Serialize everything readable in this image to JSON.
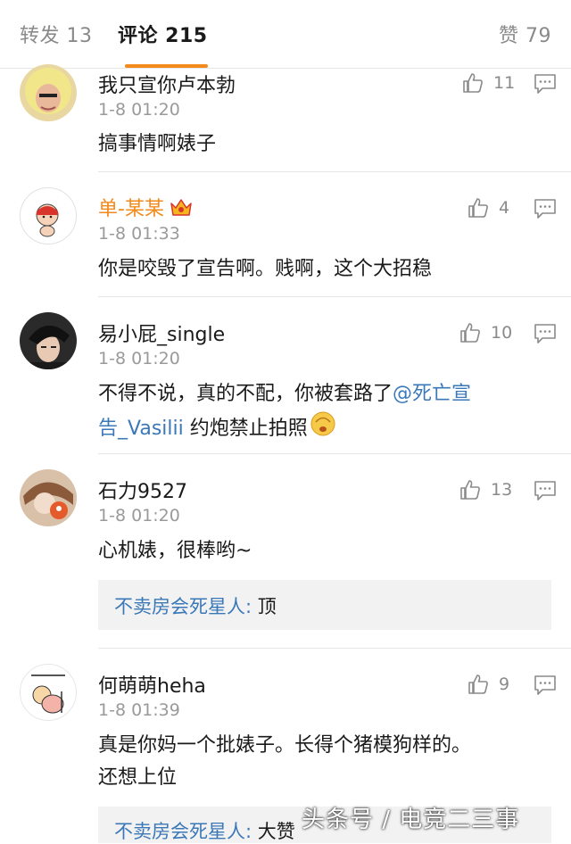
{
  "tabs": {
    "repost": "转发 13",
    "comment": "评论 215",
    "like": "赞 79"
  },
  "comments": [
    {
      "user": "我只宣你卢本勃",
      "time": "1-8 01:20",
      "text": "搞事情啊婊子",
      "likes": "11",
      "avatar": "blonde-avatar"
    },
    {
      "user": "单-某某",
      "time": "1-8 01:33",
      "text": "你是咬毁了宣告啊。贱啊，这个大招稳",
      "likes": "4",
      "avatar": "cartoon-avatar",
      "name_color": "#f28a1c"
    },
    {
      "user": "易小屁_single",
      "time": "1-8 01:20",
      "text_a": "不得不说，真的不配，你被套路了",
      "mention_a": "@死亡宣",
      "mention_b": "告_Vasilii",
      "text_b": " 约炮禁止拍照",
      "likes": "10",
      "avatar": "dark-hair-avatar"
    },
    {
      "user": "石力9527",
      "time": "1-8 01:20",
      "text": "心机婊，很棒哟~",
      "likes": "13",
      "avatar": "anime-avatar",
      "reply": {
        "who": "不卖房会死星人:",
        "text": " 顶"
      }
    },
    {
      "user": "何萌萌heha",
      "time": "1-8 01:39",
      "text_line1": "真是你妈一个批婊子。长得个猪模狗样的。",
      "text_line2": "还想上位",
      "likes": "9",
      "avatar": "meme-avatar",
      "reply": {
        "who": "不卖房会死星人:",
        "text": " 大赞"
      }
    }
  ],
  "watermark": "头条号 / 电竞二三事",
  "colors": {
    "accent": "#f28a1c",
    "link": "#3a78b8",
    "muted": "#9a9a9a"
  }
}
